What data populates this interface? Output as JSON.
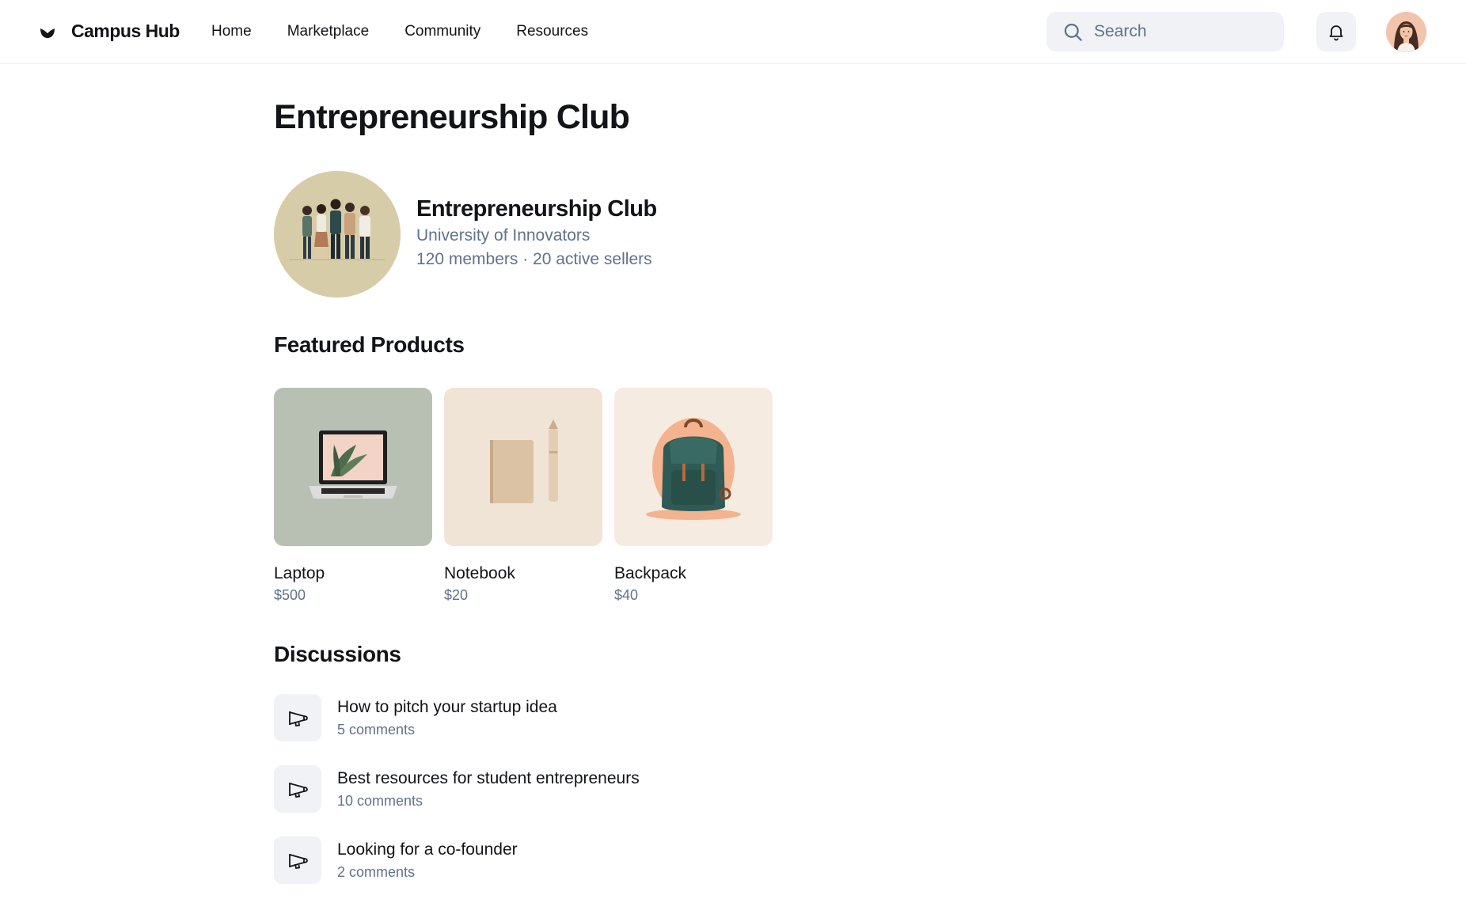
{
  "header": {
    "brand": "Campus Hub",
    "nav": [
      "Home",
      "Marketplace",
      "Community",
      "Resources"
    ],
    "search_placeholder": "Search",
    "icons": {
      "logo": "leaf-logo-icon",
      "search": "search-icon",
      "notifications": "bell-icon",
      "avatar": "user-avatar"
    }
  },
  "page": {
    "title": "Entrepreneurship Club"
  },
  "club": {
    "name": "Entrepreneurship Club",
    "university": "University of Innovators",
    "stats": "120 members · 20 active sellers",
    "image": "group-of-students-illustration"
  },
  "featured": {
    "title": "Featured Products",
    "products": [
      {
        "name": "Laptop",
        "price": "$500",
        "image": "laptop-illustration"
      },
      {
        "name": "Notebook",
        "price": "$20",
        "image": "notebook-illustration"
      },
      {
        "name": "Backpack",
        "price": "$40",
        "image": "backpack-illustration"
      }
    ]
  },
  "discussions": {
    "title": "Discussions",
    "items": [
      {
        "title": "How to pitch your startup idea",
        "comments": "5 comments",
        "icon": "megaphone-icon"
      },
      {
        "title": "Best resources for student entrepreneurs",
        "comments": "10 comments",
        "icon": "megaphone-icon"
      },
      {
        "title": "Looking for a co-founder",
        "comments": "2 comments",
        "icon": "megaphone-icon"
      }
    ]
  },
  "colors": {
    "text": "#121417",
    "muted": "#61728a",
    "chip_bg": "#f0f2f5",
    "laptop_bg": "#b8c0b4",
    "notebook_bg": "#f0e4d6",
    "backpack_bg": "#f6ebe0"
  }
}
